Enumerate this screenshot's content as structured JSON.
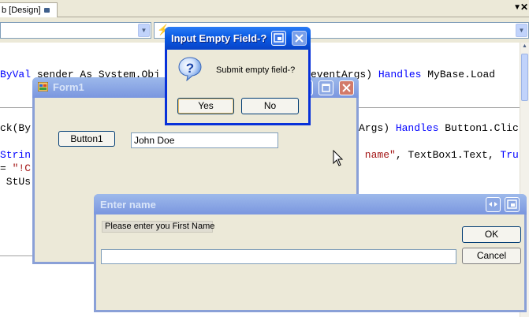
{
  "ide": {
    "tab_label": "b [Design]",
    "code_lines": {
      "line1_kw": "ByVal",
      "line1_mid": " sender As System.Obj",
      "line1_tail_a": "eventArgs) ",
      "line1_kw2": "Handles",
      "line1_tail_b": " MyBase.Load",
      "line2_head": "ck(By",
      "line2_tail_a": "Args) ",
      "line2_kw": "Handles",
      "line2_tail_b": " Button1.Clic",
      "line3_kw": "Strin",
      "line3_str": " name\"",
      "line3_tail": ", TextBox1.Text, ",
      "line3_kw2": "Tru",
      "line4_head": "= ",
      "line4_str": "\"!C",
      "line5_head": " StUs"
    }
  },
  "form1": {
    "title": "Form1",
    "button_label": "Button1",
    "textbox_value": "John Doe"
  },
  "enter_name": {
    "title": "Enter name",
    "prompt": "Please enter you First Name",
    "ok_label": "OK",
    "cancel_label": "Cancel",
    "input_value": ""
  },
  "message_box": {
    "title": "Input Empty Field-?",
    "message": "Submit empty field-?",
    "yes_label": "Yes",
    "no_label": "No",
    "icon": "question-icon"
  },
  "colors": {
    "active_title": "#0a5be5",
    "inactive_title": "#9db9eb",
    "window_face": "#ece9d8",
    "keyword": "#0000ff",
    "string": "#a31515"
  }
}
